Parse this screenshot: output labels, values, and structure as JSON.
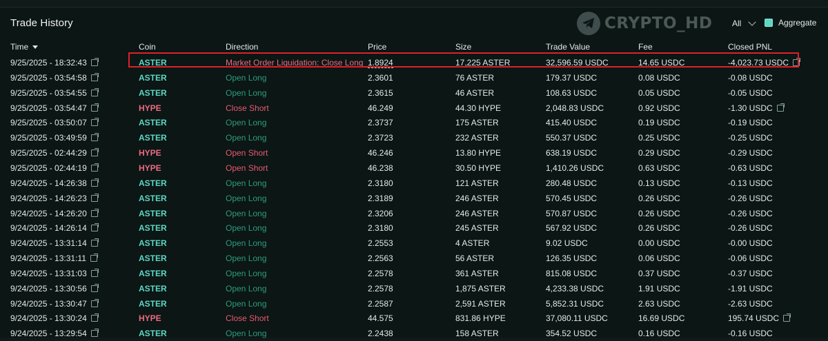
{
  "panel": {
    "title": "Trade History",
    "watermark": "CRYPTO_HD",
    "filter_label": "All",
    "aggregate_label": "Aggregate",
    "aggregate_checked": true
  },
  "columns": {
    "time": "Time",
    "coin": "Coin",
    "direction": "Direction",
    "price": "Price",
    "size": "Size",
    "trade_value": "Trade Value",
    "fee": "Fee",
    "closed_pnl": "Closed PNL"
  },
  "colors": {
    "coin_aster": "#5fd7c3",
    "coin_hype": "#ef6b80",
    "dir_long": "#2f9c7f",
    "dir_short": "#ea5a6e",
    "highlight_box": "#e0202a"
  },
  "rows": [
    {
      "time": "9/25/2025 - 18:32:43",
      "coin": "ASTER",
      "direction": "Market Order Liquidation: Close Long",
      "price": "1.8924",
      "size": "17,225 ASTER",
      "value": "32,596.59 USDC",
      "fee": "14.65 USDC",
      "pnl": "-4,023.73 USDC",
      "link": true,
      "highlighted": true
    },
    {
      "time": "9/25/2025 - 03:54:58",
      "coin": "ASTER",
      "direction": "Open Long",
      "price": "2.3601",
      "size": "76 ASTER",
      "value": "179.37 USDC",
      "fee": "0.08 USDC",
      "pnl": "-0.08 USDC",
      "link": false
    },
    {
      "time": "9/25/2025 - 03:54:55",
      "coin": "ASTER",
      "direction": "Open Long",
      "price": "2.3615",
      "size": "46 ASTER",
      "value": "108.63 USDC",
      "fee": "0.05 USDC",
      "pnl": "-0.05 USDC",
      "link": false
    },
    {
      "time": "9/25/2025 - 03:54:47",
      "coin": "HYPE",
      "direction": "Close Short",
      "price": "46.249",
      "size": "44.30 HYPE",
      "value": "2,048.83 USDC",
      "fee": "0.92 USDC",
      "pnl": "-1.30 USDC",
      "link": true
    },
    {
      "time": "9/25/2025 - 03:50:07",
      "coin": "ASTER",
      "direction": "Open Long",
      "price": "2.3737",
      "size": "175 ASTER",
      "value": "415.40 USDC",
      "fee": "0.19 USDC",
      "pnl": "-0.19 USDC",
      "link": false
    },
    {
      "time": "9/25/2025 - 03:49:59",
      "coin": "ASTER",
      "direction": "Open Long",
      "price": "2.3723",
      "size": "232 ASTER",
      "value": "550.37 USDC",
      "fee": "0.25 USDC",
      "pnl": "-0.25 USDC",
      "link": false
    },
    {
      "time": "9/25/2025 - 02:44:29",
      "coin": "HYPE",
      "direction": "Open Short",
      "price": "46.246",
      "size": "13.80 HYPE",
      "value": "638.19 USDC",
      "fee": "0.29 USDC",
      "pnl": "-0.29 USDC",
      "link": false
    },
    {
      "time": "9/25/2025 - 02:44:19",
      "coin": "HYPE",
      "direction": "Open Short",
      "price": "46.238",
      "size": "30.50 HYPE",
      "value": "1,410.26 USDC",
      "fee": "0.63 USDC",
      "pnl": "-0.63 USDC",
      "link": false
    },
    {
      "time": "9/24/2025 - 14:26:38",
      "coin": "ASTER",
      "direction": "Open Long",
      "price": "2.3180",
      "size": "121 ASTER",
      "value": "280.48 USDC",
      "fee": "0.13 USDC",
      "pnl": "-0.13 USDC",
      "link": false
    },
    {
      "time": "9/24/2025 - 14:26:23",
      "coin": "ASTER",
      "direction": "Open Long",
      "price": "2.3189",
      "size": "246 ASTER",
      "value": "570.45 USDC",
      "fee": "0.26 USDC",
      "pnl": "-0.26 USDC",
      "link": false
    },
    {
      "time": "9/24/2025 - 14:26:20",
      "coin": "ASTER",
      "direction": "Open Long",
      "price": "2.3206",
      "size": "246 ASTER",
      "value": "570.87 USDC",
      "fee": "0.26 USDC",
      "pnl": "-0.26 USDC",
      "link": false
    },
    {
      "time": "9/24/2025 - 14:26:14",
      "coin": "ASTER",
      "direction": "Open Long",
      "price": "2.3180",
      "size": "245 ASTER",
      "value": "567.92 USDC",
      "fee": "0.26 USDC",
      "pnl": "-0.26 USDC",
      "link": false
    },
    {
      "time": "9/24/2025 - 13:31:14",
      "coin": "ASTER",
      "direction": "Open Long",
      "price": "2.2553",
      "size": "4 ASTER",
      "value": "9.02 USDC",
      "fee": "0.00 USDC",
      "pnl": "-0.00 USDC",
      "link": false
    },
    {
      "time": "9/24/2025 - 13:31:11",
      "coin": "ASTER",
      "direction": "Open Long",
      "price": "2.2563",
      "size": "56 ASTER",
      "value": "126.35 USDC",
      "fee": "0.06 USDC",
      "pnl": "-0.06 USDC",
      "link": false
    },
    {
      "time": "9/24/2025 - 13:31:03",
      "coin": "ASTER",
      "direction": "Open Long",
      "price": "2.2578",
      "size": "361 ASTER",
      "value": "815.08 USDC",
      "fee": "0.37 USDC",
      "pnl": "-0.37 USDC",
      "link": false
    },
    {
      "time": "9/24/2025 - 13:30:56",
      "coin": "ASTER",
      "direction": "Open Long",
      "price": "2.2578",
      "size": "1,875 ASTER",
      "value": "4,233.38 USDC",
      "fee": "1.91 USDC",
      "pnl": "-1.91 USDC",
      "link": false
    },
    {
      "time": "9/24/2025 - 13:30:47",
      "coin": "ASTER",
      "direction": "Open Long",
      "price": "2.2587",
      "size": "2,591 ASTER",
      "value": "5,852.31 USDC",
      "fee": "2.63 USDC",
      "pnl": "-2.63 USDC",
      "link": false
    },
    {
      "time": "9/24/2025 - 13:30:24",
      "coin": "HYPE",
      "direction": "Close Short",
      "price": "44.575",
      "size": "831.86 HYPE",
      "value": "37,080.11 USDC",
      "fee": "16.69 USDC",
      "pnl": "195.74 USDC",
      "link": true
    },
    {
      "time": "9/24/2025 - 13:29:54",
      "coin": "ASTER",
      "direction": "Open Long",
      "price": "2.2438",
      "size": "158 ASTER",
      "value": "354.52 USDC",
      "fee": "0.16 USDC",
      "pnl": "-0.16 USDC",
      "link": false
    }
  ]
}
